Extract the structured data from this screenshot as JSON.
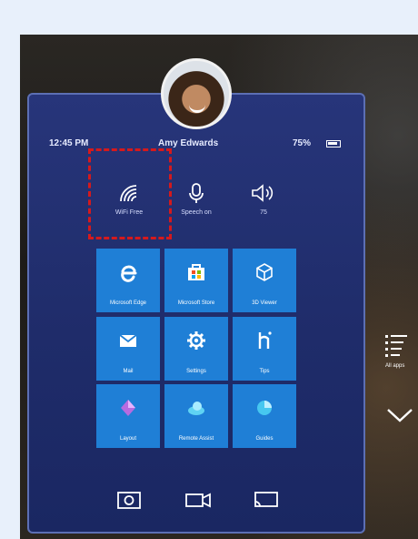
{
  "header": {
    "time": "12:45 PM",
    "user_name": "Amy Edwards",
    "battery": "75%"
  },
  "quick_actions": [
    {
      "name": "wifi",
      "label": "WiFi Free"
    },
    {
      "name": "speech",
      "label": "Speech on"
    },
    {
      "name": "volume",
      "label": "75"
    }
  ],
  "tiles": [
    {
      "label": "Microsoft Edge",
      "icon": "edge-icon"
    },
    {
      "label": "Microsoft Store",
      "icon": "store-icon"
    },
    {
      "label": "3D Viewer",
      "icon": "cube-icon"
    },
    {
      "label": "Mail",
      "icon": "mail-icon"
    },
    {
      "label": "Settings",
      "icon": "gear-icon"
    },
    {
      "label": "Tips",
      "icon": "tips-icon"
    },
    {
      "label": "Layout",
      "icon": "layout-icon"
    },
    {
      "label": "Remote Assist",
      "icon": "remote-assist-icon"
    },
    {
      "label": "Guides",
      "icon": "guides-icon"
    }
  ],
  "bottom_bar": [
    "camera-icon",
    "video-icon",
    "cast-icon"
  ],
  "side": {
    "all_apps_label": "All apps"
  },
  "colors": {
    "panel": "#27357a",
    "tile": "#1f7fd6",
    "highlight": "#d6191c"
  }
}
